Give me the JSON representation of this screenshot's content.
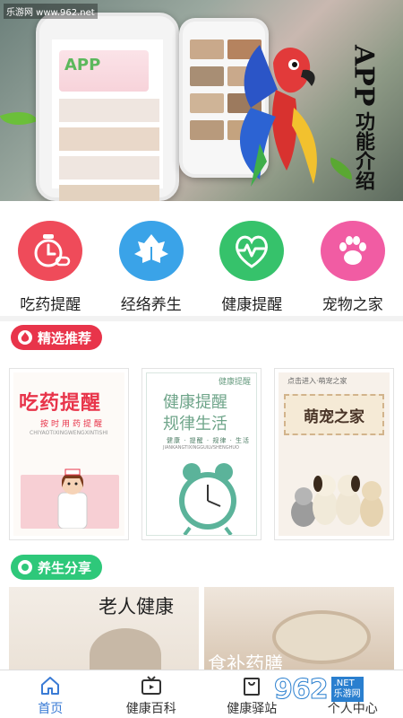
{
  "banner": {
    "watermark": "乐游网 www.962.net",
    "phone_app_label": "APP",
    "side_title_app": "APP",
    "side_title_desc": "功能介绍"
  },
  "quicknav": [
    {
      "label": "吃药提醒",
      "icon": "alarm-clock-icon",
      "color": "#ef4b5a"
    },
    {
      "label": "经络养生",
      "icon": "leaf-icon",
      "color": "#3aa3e8"
    },
    {
      "label": "健康提醒",
      "icon": "heart-pulse-icon",
      "color": "#36c26b"
    },
    {
      "label": "宠物之家",
      "icon": "paw-icon",
      "color": "#f15ca3"
    }
  ],
  "featured": {
    "title": "精选推荐",
    "color": "#e8344a",
    "posters": [
      {
        "title": "吃药提醒",
        "sub": "按时用药提醒",
        "pinyin": "CHIYAOTIXINGWENGXINTISHI"
      },
      {
        "badge": "健康提醒",
        "line1": "健康提醒",
        "line2": "规律生活",
        "tags": "健康 · 提醒 · 规律 · 生活",
        "pinyin": "JIANKANGTIXINGGUILVSHENGHUO"
      },
      {
        "top": "点击进入·萌宠之家",
        "title": "萌宠之家"
      }
    ]
  },
  "share": {
    "title": "养生分享",
    "color": "#2ec87a",
    "cards": [
      {
        "title": "老人健康"
      },
      {
        "title": "食补药膳"
      }
    ]
  },
  "tabs": [
    {
      "label": "首页",
      "icon": "home-icon",
      "active": true
    },
    {
      "label": "健康百科",
      "icon": "tv-icon",
      "active": false
    },
    {
      "label": "健康驿站",
      "icon": "bag-icon",
      "active": false
    },
    {
      "label": "个人中心",
      "icon": "user-icon",
      "active": false
    }
  ],
  "corner_watermark": {
    "number": "962",
    "suffix": ".NET",
    "site": "乐游网"
  }
}
